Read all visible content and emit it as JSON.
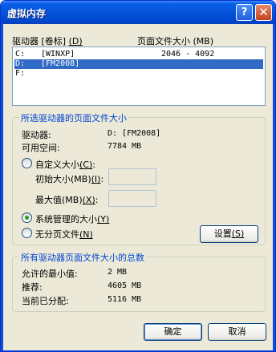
{
  "window": {
    "title": "虚拟内存",
    "help_glyph": "?",
    "close_glyph": "✕"
  },
  "drives": {
    "header_drive": "驱动器 [卷标]",
    "header_drive_key": "(D)",
    "header_size": "页面文件大小 (MB)",
    "rows": [
      {
        "letter": "C:",
        "label": "[WINXP]",
        "size": "2046 - 4092",
        "selected": false
      },
      {
        "letter": "D:",
        "label": "[FM2008]",
        "size": "",
        "selected": true
      },
      {
        "letter": "F:",
        "label": "",
        "size": "",
        "selected": false
      }
    ]
  },
  "selected_drive": {
    "group_title": "所选驱动器的页面文件大小",
    "drive_label": "驱动器:",
    "drive_value": "D:  [FM2008]",
    "space_label": "可用空间:",
    "space_value": "7784 MB",
    "custom_size_label": "自定义大小",
    "custom_size_key": "(C)",
    "custom_size_colon": ":",
    "initial_label": "初始大小(MB)",
    "initial_key": "(I)",
    "initial_colon": ":",
    "initial_value": "",
    "max_label": "最大值(MB)",
    "max_key": "(X)",
    "max_colon": ":",
    "max_value": "",
    "system_managed_label": "系统管理的大小",
    "system_managed_key": "(Y)",
    "no_paging_label": "无分页文件",
    "no_paging_key": "(N)",
    "selected_option": "system_managed",
    "set_button": "设置",
    "set_button_key": "(S)"
  },
  "totals": {
    "group_title": "所有驱动器页面文件大小的总数",
    "min_label": "允许的最小值:",
    "min_value": "2 MB",
    "recommended_label": "推荐:",
    "recommended_value": "4605 MB",
    "allocated_label": "当前已分配:",
    "allocated_value": "5116 MB"
  },
  "buttons": {
    "ok": "确定",
    "cancel": "取消"
  }
}
